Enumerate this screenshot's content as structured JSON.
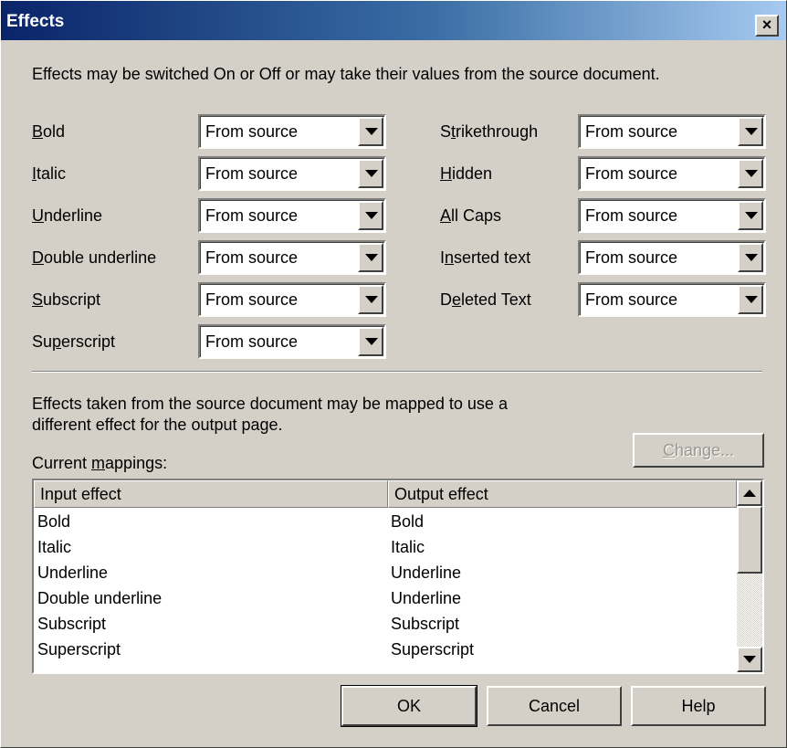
{
  "window": {
    "title": "Effects",
    "close_label": "×"
  },
  "intro_text": "Effects may be switched On or Off or may take their values from the source document.",
  "effects_left": [
    {
      "pre": "",
      "key": "B",
      "post": "old",
      "value": "From source"
    },
    {
      "pre": "",
      "key": "I",
      "post": "talic",
      "value": "From source"
    },
    {
      "pre": "",
      "key": "U",
      "post": "nderline",
      "value": "From source"
    },
    {
      "pre": "",
      "key": "D",
      "post": "ouble underline",
      "value": "From source"
    },
    {
      "pre": "",
      "key": "S",
      "post": "ubscript",
      "value": "From source"
    },
    {
      "pre": "Su",
      "key": "p",
      "post": "erscript",
      "value": "From source"
    }
  ],
  "effects_right": [
    {
      "pre": "S",
      "key": "t",
      "post": "rikethrough",
      "value": "From source"
    },
    {
      "pre": "",
      "key": "H",
      "post": "idden",
      "value": "From source"
    },
    {
      "pre": "",
      "key": "A",
      "post": "ll Caps",
      "value": "From source"
    },
    {
      "pre": "I",
      "key": "n",
      "post": "serted text",
      "value": "From source"
    },
    {
      "pre": "D",
      "key": "e",
      "post": "leted Text",
      "value": "From source"
    }
  ],
  "mapping_text_line1": "Effects taken from the source document may be mapped to use a",
  "mapping_text_line2": "different effect for the output page.",
  "current_mappings": {
    "pre": "Current ",
    "key": "m",
    "post": "appings:"
  },
  "change_button": {
    "key": "C",
    "post": "hange..."
  },
  "list": {
    "columns": [
      "Input effect",
      "Output effect"
    ],
    "rows": [
      [
        "Bold",
        "Bold"
      ],
      [
        "Italic",
        "Italic"
      ],
      [
        "Underline",
        "Underline"
      ],
      [
        "Double underline",
        "Underline"
      ],
      [
        "Subscript",
        "Subscript"
      ],
      [
        "Superscript",
        "Superscript"
      ]
    ]
  },
  "buttons": {
    "ok": "OK",
    "cancel": "Cancel",
    "help": "Help"
  }
}
